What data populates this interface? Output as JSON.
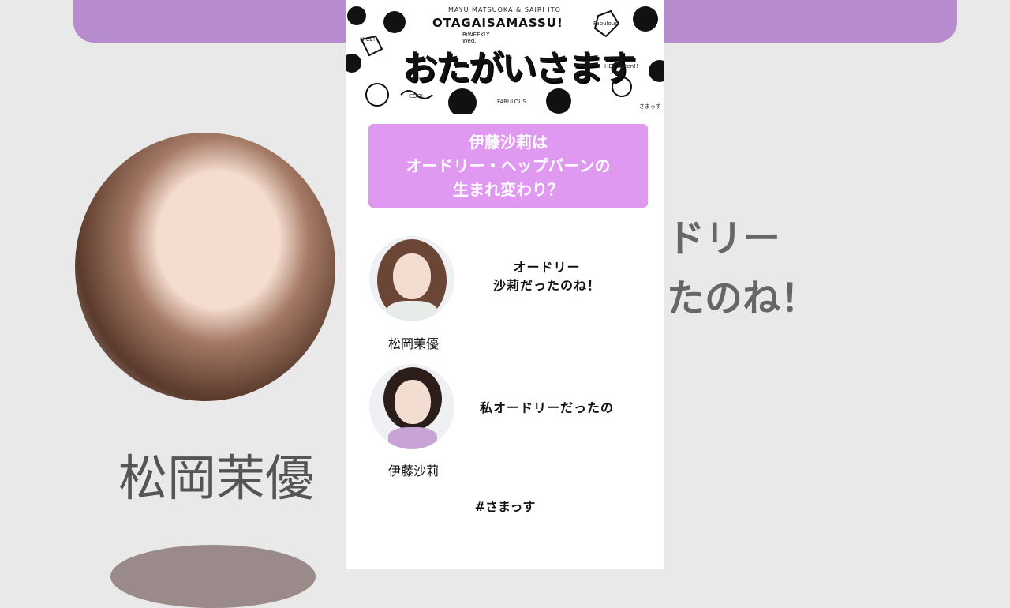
{
  "header": {
    "subtitle": "MAYU MATSUOKA  &  SAIRI ITO",
    "english_title": "OTAGAISAMASSU!",
    "weekly_label_line1": "BiWEEKLY",
    "weekly_label_line2": "Wed.",
    "logo_text": "おたがいさます",
    "doodles": [
      "HEY Listen!!",
      "FABULOUS",
      "COOL",
      "NICE!",
      "Fabulous",
      "さまっす"
    ]
  },
  "title": {
    "line1": "伊藤沙莉は",
    "line2": "オードリー・ヘップバーンの",
    "line3": "生まれ変わり？",
    "background_color": "#df99f1"
  },
  "dialogue": [
    {
      "speaker": "松岡茉優",
      "quote_line1": "オードリー",
      "quote_line2": "沙莉だったのね！"
    },
    {
      "speaker": "伊藤沙莉",
      "quote_line1": "私オードリーだったの"
    }
  ],
  "hashtag": "#さまっす",
  "background": {
    "name_text": "松岡茉優",
    "quote_text_line1": "ドリー",
    "quote_text_line2": "たのね！"
  }
}
